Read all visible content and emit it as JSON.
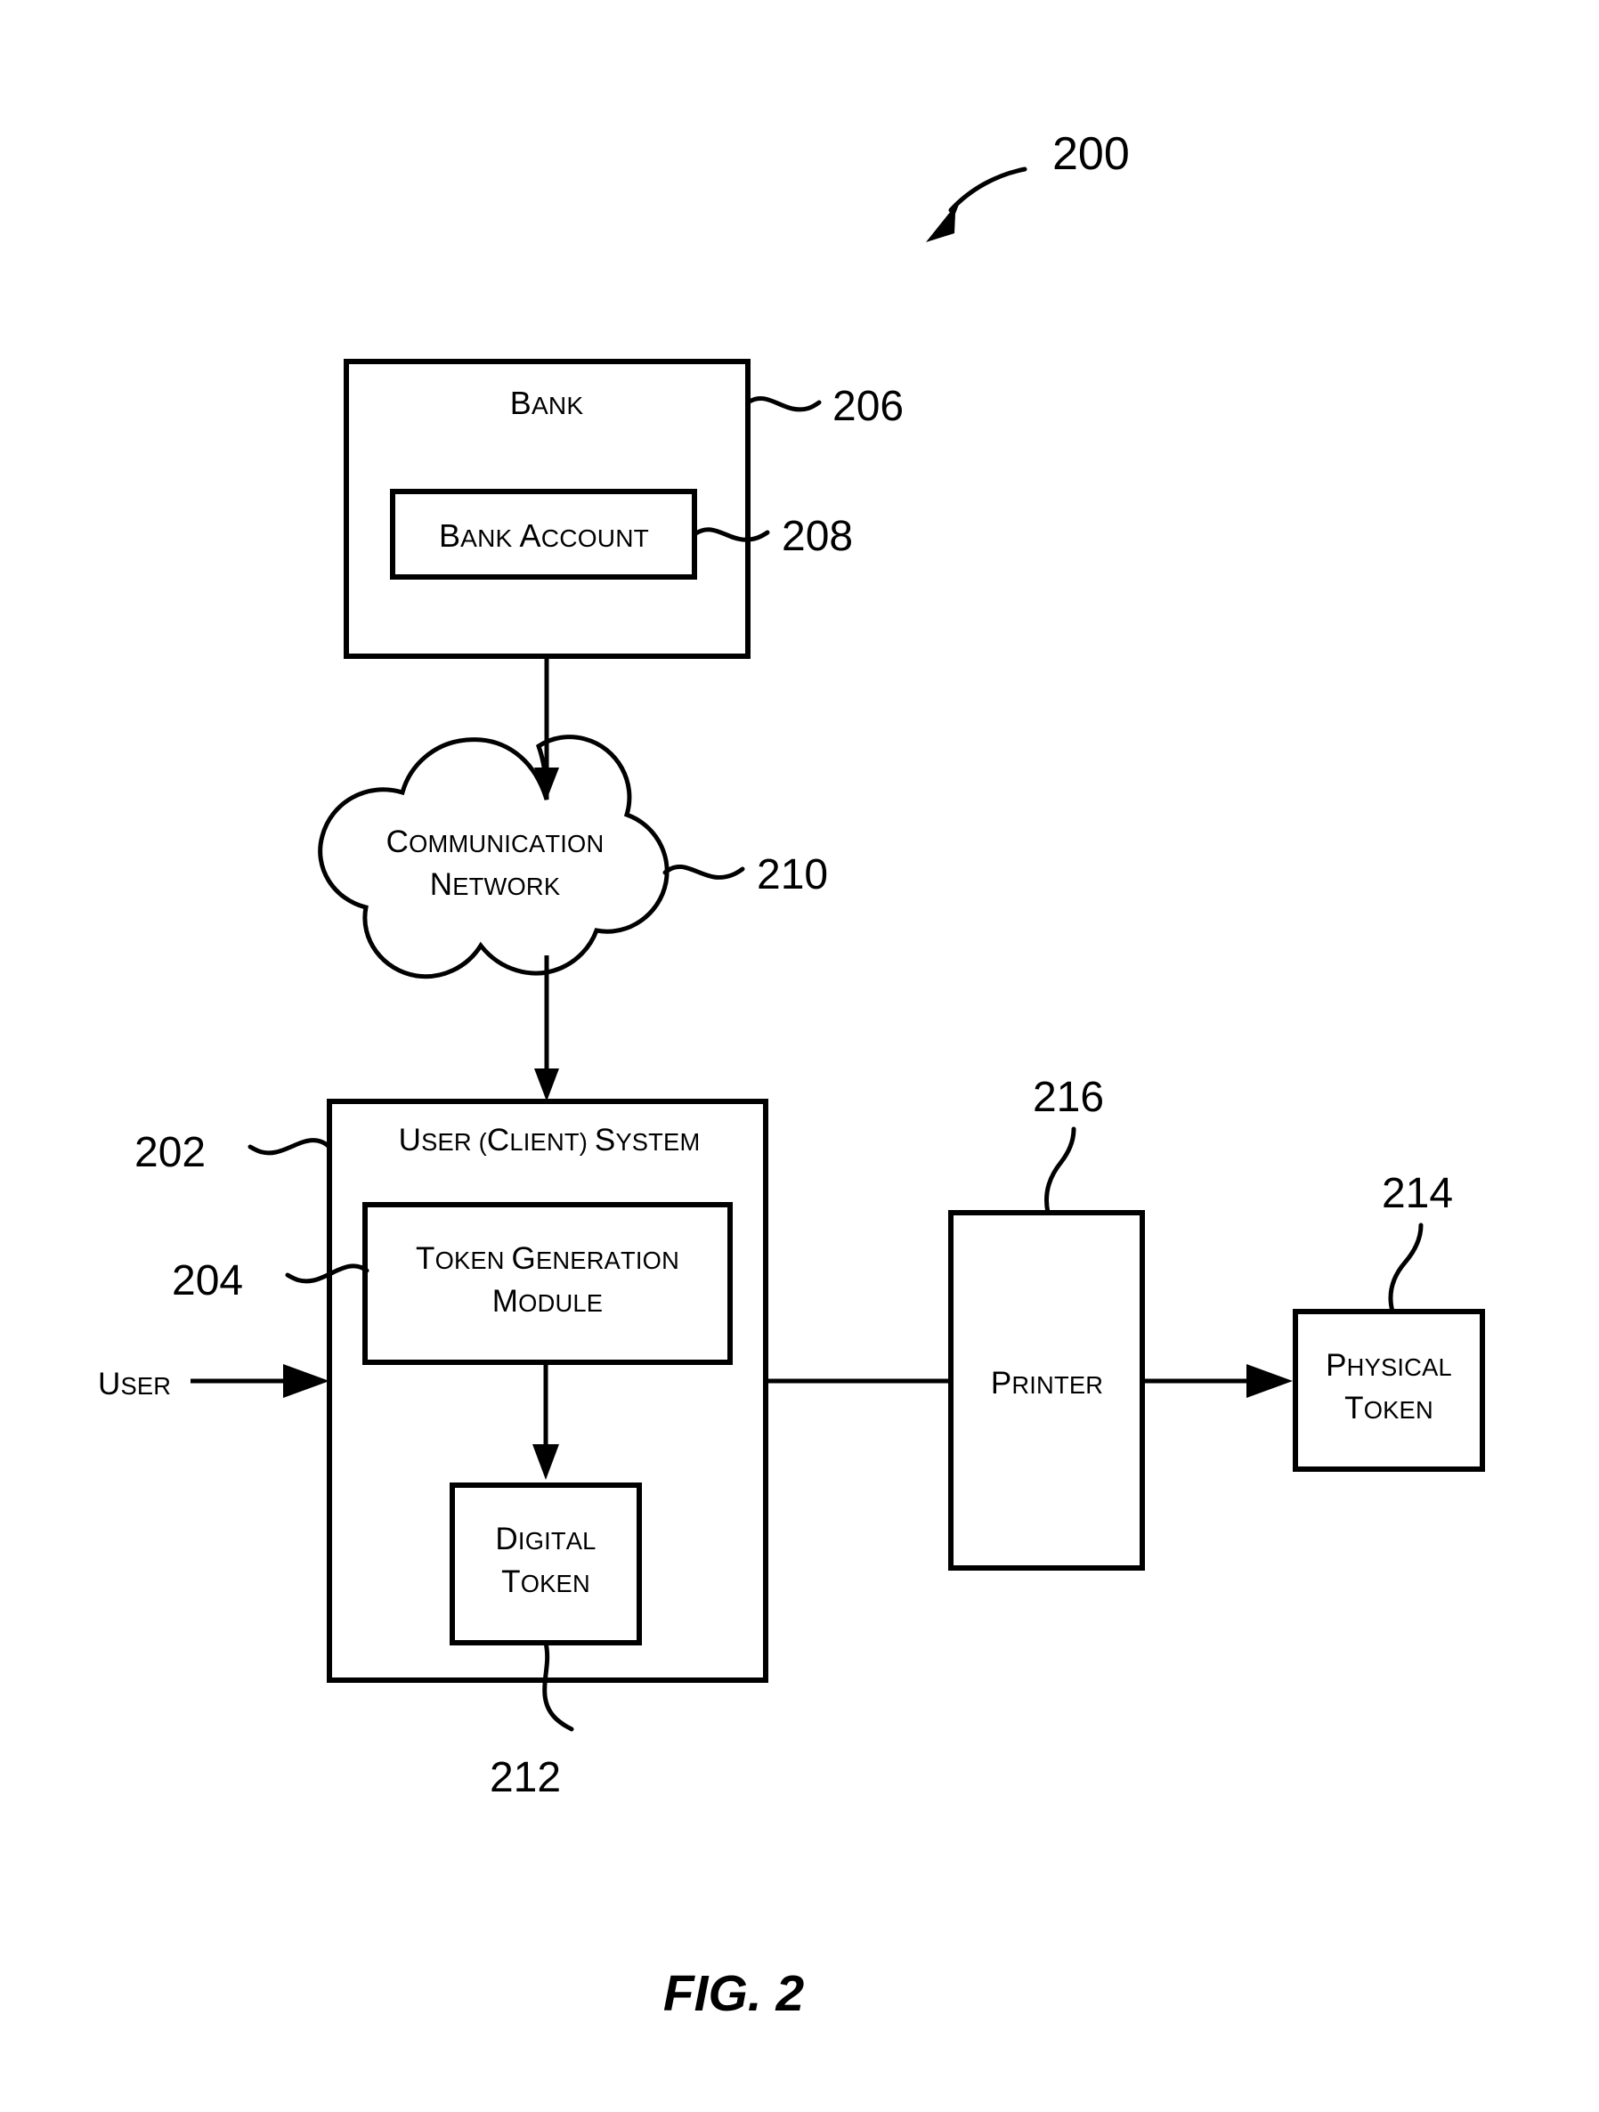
{
  "figure": {
    "caption": "FIG. 2",
    "system_ref": "200"
  },
  "nodes": {
    "bank": {
      "label": "BANK",
      "ref": "206",
      "shape": "rectangle"
    },
    "bank_account": {
      "label": "BANK ACCOUNT",
      "ref": "208",
      "shape": "rectangle"
    },
    "communication_network": {
      "label_line1": "COMMUNICATION",
      "label_line2": "NETWORK",
      "ref": "210",
      "shape": "cloud"
    },
    "user_client_system": {
      "label": "USER (CLIENT) SYSTEM",
      "ref": "202",
      "shape": "rectangle"
    },
    "token_generation_module": {
      "label_line1": "TOKEN GENERATION",
      "label_line2": "MODULE",
      "ref": "204",
      "shape": "rectangle"
    },
    "digital_token": {
      "label_line1": "DIGITAL",
      "label_line2": "TOKEN",
      "ref": "212",
      "shape": "rectangle"
    },
    "printer": {
      "label": "PRINTER",
      "ref": "216",
      "shape": "rectangle"
    },
    "physical_token": {
      "label_line1": "PHYSICAL",
      "label_line2": "TOKEN",
      "ref": "214",
      "shape": "rectangle"
    },
    "user": {
      "label": "USER"
    }
  },
  "colors": {
    "line": "#000000",
    "background": "#ffffff",
    "text": "#000000"
  }
}
